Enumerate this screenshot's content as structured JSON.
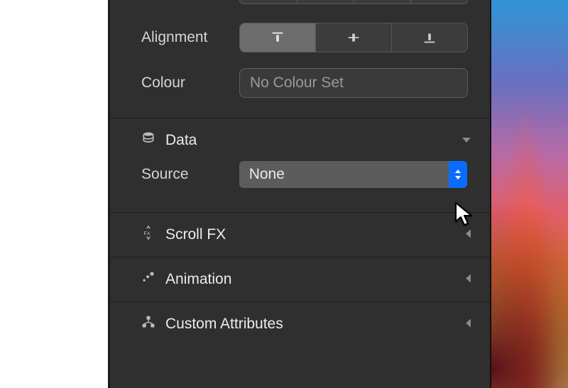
{
  "top": {
    "alignment_label": "Alignment",
    "alignment_options": [
      "top",
      "middle",
      "bottom"
    ],
    "alignment_selected": "top",
    "colour_label": "Colour",
    "colour_value": "No Colour Set"
  },
  "data_section": {
    "title": "Data",
    "source_label": "Source",
    "source_value": "None",
    "expanded": true
  },
  "scrollfx_section": {
    "title": "Scroll FX",
    "expanded": false
  },
  "animation_section": {
    "title": "Animation",
    "expanded": false
  },
  "custom_attrs_section": {
    "title": "Custom Attributes",
    "expanded": false
  }
}
